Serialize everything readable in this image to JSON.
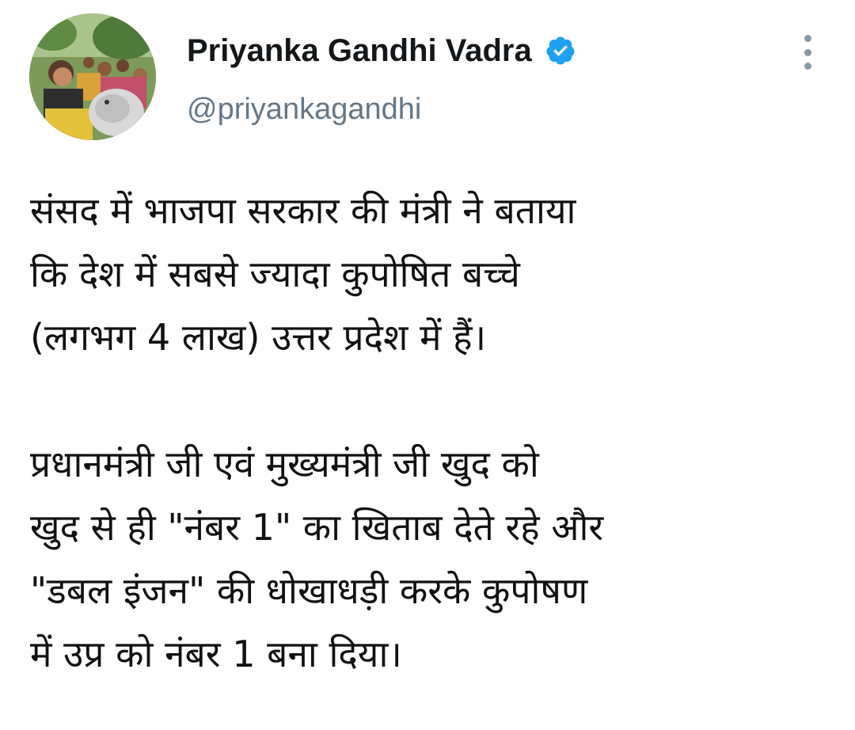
{
  "author": {
    "display_name": "Priyanka Gandhi Vadra",
    "handle": "@priyankagandhi",
    "verified": true,
    "verified_color": "#1da1f2",
    "avatar_icon": "profile-photo"
  },
  "menu": {
    "icon": "more-vertical-icon",
    "color": "#8899a6"
  },
  "tweet": {
    "paragraph1": [
      "संसद में भाजपा सरकार की मंत्री ने बताया",
      "कि देश में सबसे ज्यादा कुपोषित बच्चे",
      "(लगभग 4 लाख) उत्तर प्रदेश में हैं।"
    ],
    "paragraph2": [
      "प्रधानमंत्री जी एवं मुख्यमंत्री जी खुद को",
      "खुद से ही \"नंबर 1\" का खिताब देते रहे और",
      "\"डबल इंजन\"  की धोखाधड़ी करके कुपोषण",
      "में उप्र को नंबर 1 बना दिया।"
    ]
  }
}
